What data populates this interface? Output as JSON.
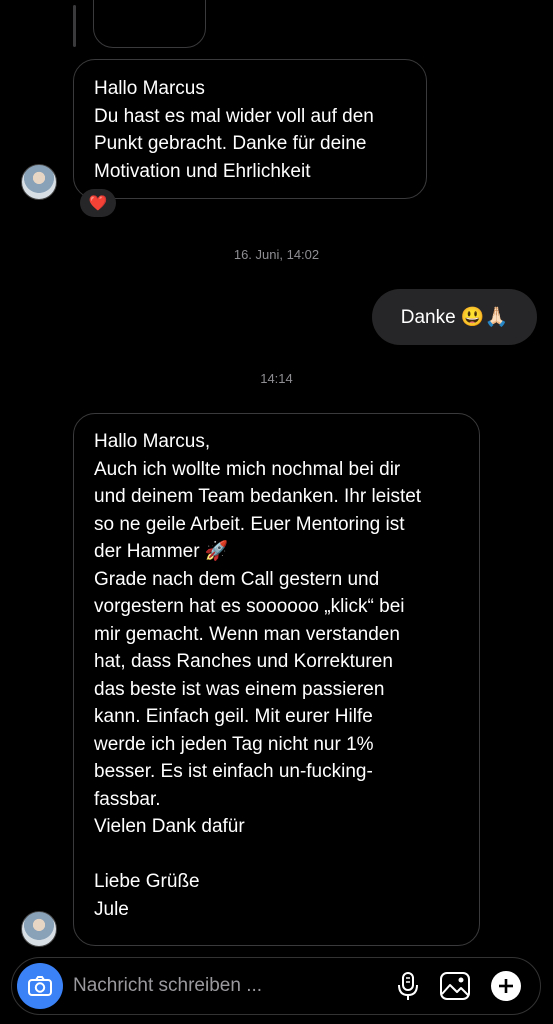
{
  "thread": {
    "message_1": {
      "lines": [
        "Hallo Marcus",
        "Du hast es mal wider voll auf den",
        "Punkt gebracht. Danke für deine",
        "Motivation und Ehrlichkeit"
      ],
      "reaction": "❤️"
    },
    "timestamp_1": "16. Juni, 14:02",
    "outgoing_1": {
      "text": "Danke 😃🙏🏻"
    },
    "timestamp_2": "14:14",
    "message_2": {
      "lines": [
        "Hallo Marcus,",
        "Auch ich wollte mich nochmal bei dir",
        "und deinem Team bedanken. Ihr leistet",
        "so ne geile Arbeit. Euer Mentoring ist",
        "der Hammer 🚀",
        "Grade nach dem Call gestern und",
        "vorgestern hat es soooooo „klick“ bei",
        "mir gemacht. Wenn man verstanden",
        "hat, dass Ranches und Korrekturen",
        "das beste ist was einem passieren",
        "kann. Einfach geil. Mit eurer Hilfe",
        "werde ich jeden Tag nicht nur 1%",
        "besser. Es ist einfach un-fucking-",
        "fassbar.",
        "Vielen Dank dafür",
        "",
        "Liebe Grüße",
        "Jule"
      ]
    }
  },
  "composer": {
    "placeholder": "Nachricht schreiben ...",
    "icons": [
      "camera-icon",
      "microphone-icon",
      "gallery-icon",
      "plus-icon"
    ]
  },
  "colors": {
    "background": "#000000",
    "incoming_border": "#3a3a3c",
    "outgoing_bubble": "#262628",
    "timestamp": "#8e8e93",
    "camera_button": "#3b82f6"
  }
}
